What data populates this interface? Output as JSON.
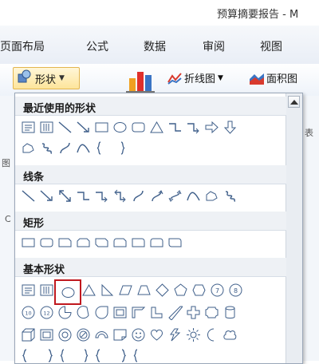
{
  "window": {
    "title": "预算摘要报告 - M"
  },
  "ribbon": {
    "tabs": [
      {
        "label": "页面布局"
      },
      {
        "label": "公式"
      },
      {
        "label": "数据"
      },
      {
        "label": "审阅"
      },
      {
        "label": "视图"
      }
    ],
    "shapes_button": {
      "label": "形状",
      "icon": "shapes-icon"
    },
    "line_chart_button": {
      "label": "折线图",
      "icon": "line-chart-icon"
    },
    "area_chart_button": {
      "label": "面积图",
      "icon": "area-chart-icon"
    },
    "column_chart_icon": "column-chart-icon"
  },
  "background": {
    "left_chars": [
      "图",
      "C"
    ],
    "right_chars": [
      "表"
    ]
  },
  "panel": {
    "sections": [
      {
        "title": "最近使用的形状"
      },
      {
        "title": "线条"
      },
      {
        "title": "矩形"
      },
      {
        "title": "基本形状"
      }
    ],
    "selected_shape": "oval",
    "scroll_icon": "scroll-up-arrow-icon"
  },
  "colors": {
    "selection": "#c0181e",
    "accent_orange": "#f0a020",
    "shape_stroke": "#3f5f8a",
    "shape_fill": "#dbe7f5"
  }
}
